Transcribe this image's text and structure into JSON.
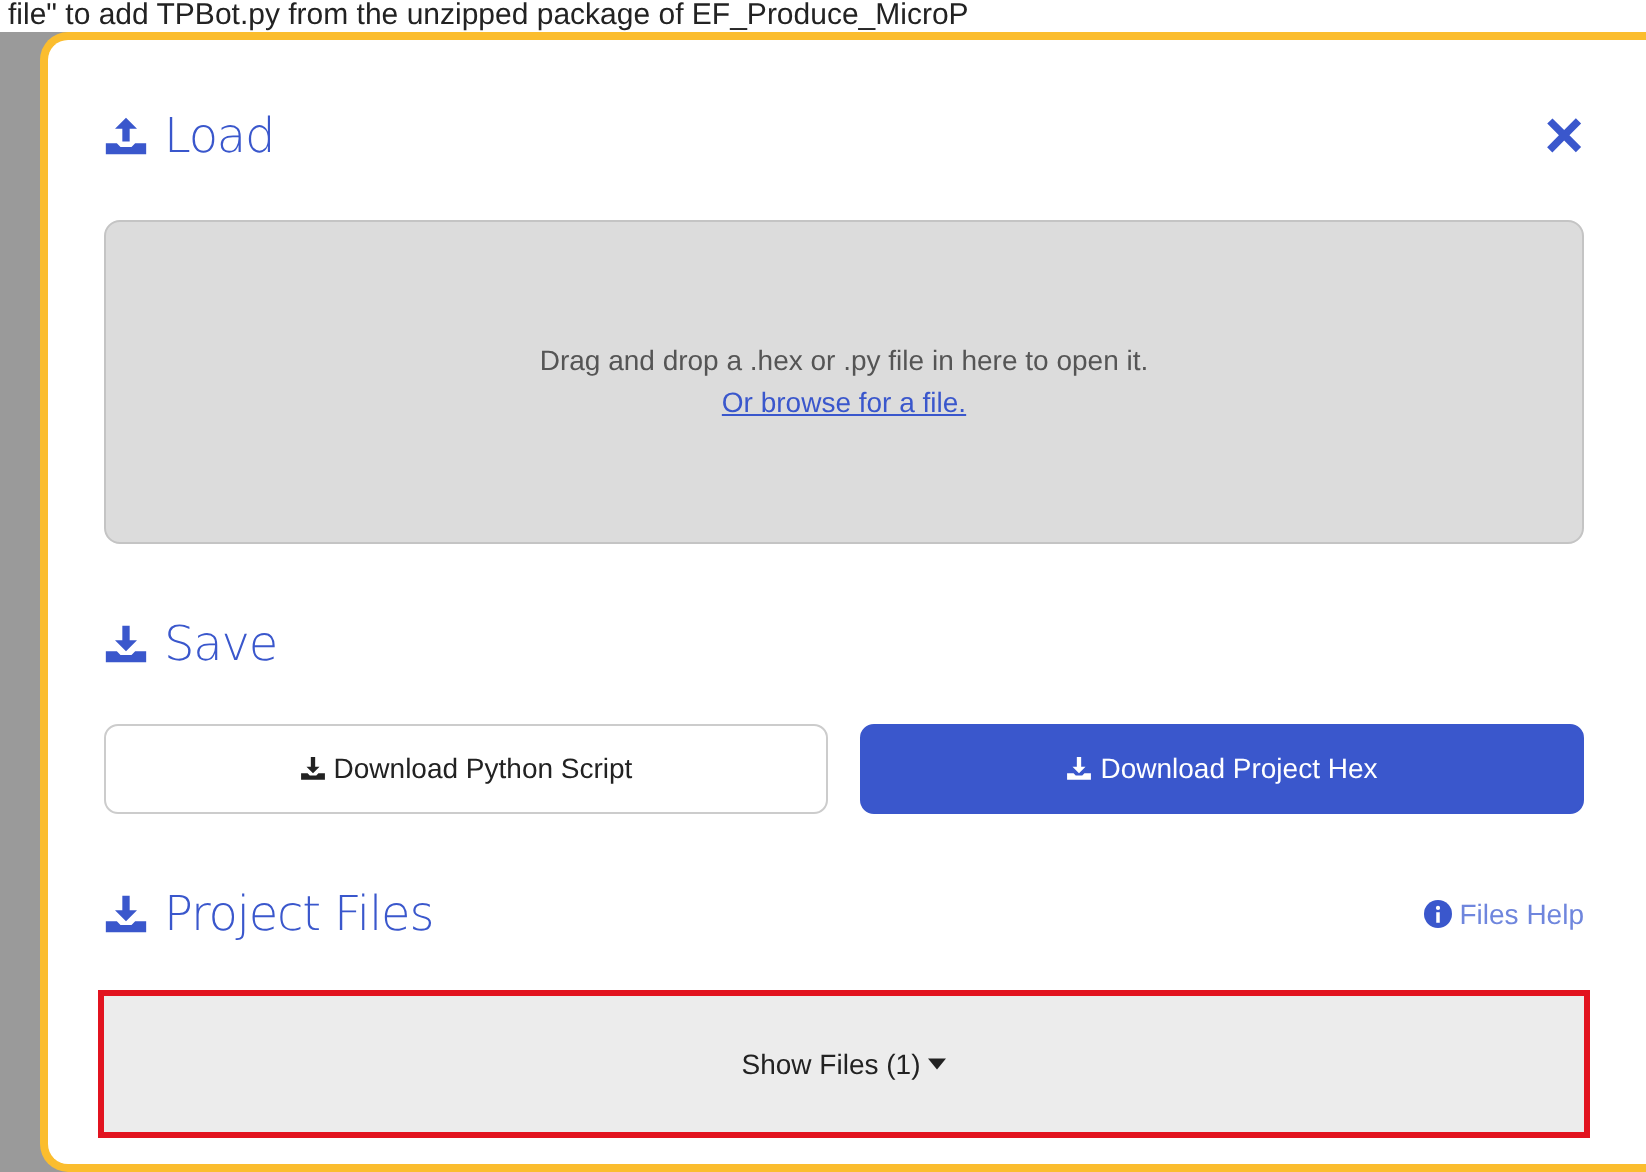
{
  "background_text": "file\" to add TPBot.py from the unzipped package of EF_Produce_MicroP",
  "dialog": {
    "close": "×",
    "load": {
      "title": "Load",
      "drop_text": "Drag and drop a .hex or .py file in here to open it.",
      "browse_link": "Or browse for a file."
    },
    "save": {
      "title": "Save",
      "buttons": [
        {
          "label": "Download Python Script",
          "kind": "secondary"
        },
        {
          "label": "Download Project Hex",
          "kind": "primary"
        }
      ]
    },
    "project_files": {
      "title": "Project Files",
      "help_link": "Files Help",
      "show_files": {
        "label": "Show Files (1)",
        "highlighted": true
      }
    }
  }
}
